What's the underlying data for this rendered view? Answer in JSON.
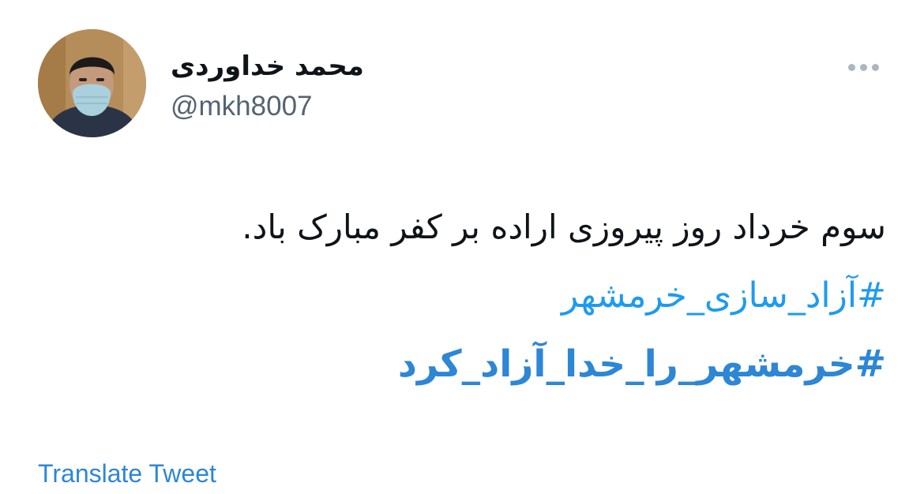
{
  "author": {
    "name": "محمد خداوردی",
    "handle": "@mkh8007"
  },
  "tweet": {
    "text": "سوم خرداد روز پیروزی اراده بر کفر مبارک باد.",
    "hashtags": [
      "#آزاد_سازی_خرمشهر",
      "#خرمشهر_را_خدا_آزاد_کرد"
    ]
  },
  "actions": {
    "translate_label": "Translate Tweet",
    "more_icon": "more-options-icon"
  },
  "colors": {
    "link": "#1d9bf0",
    "secondary_text": "#536471",
    "primary_text": "#0f1419"
  }
}
